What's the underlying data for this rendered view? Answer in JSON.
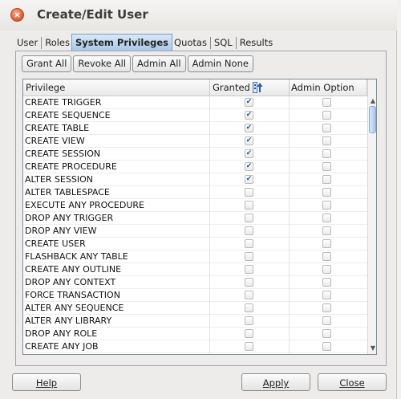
{
  "window": {
    "title": "Create/Edit User",
    "close_glyph": "×"
  },
  "tabs": [
    {
      "label": "User",
      "active": false
    },
    {
      "label": "Roles",
      "active": false
    },
    {
      "label": "System Privileges",
      "active": true
    },
    {
      "label": "Quotas",
      "active": false
    },
    {
      "label": "SQL",
      "active": false
    },
    {
      "label": "Results",
      "active": false
    }
  ],
  "toolbar": {
    "grant_all": "Grant All",
    "revoke_all": "Revoke All",
    "admin_all": "Admin All",
    "admin_none": "Admin None"
  },
  "table": {
    "columns": {
      "privilege": "Privilege",
      "granted": "Granted",
      "admin_option": "Admin Option"
    },
    "sort_icon": "sort-icon",
    "rows": [
      {
        "privilege": "CREATE TRIGGER",
        "granted": true,
        "admin": false
      },
      {
        "privilege": "CREATE SEQUENCE",
        "granted": true,
        "admin": false
      },
      {
        "privilege": "CREATE TABLE",
        "granted": true,
        "admin": false
      },
      {
        "privilege": "CREATE VIEW",
        "granted": true,
        "admin": false
      },
      {
        "privilege": "CREATE SESSION",
        "granted": true,
        "admin": false
      },
      {
        "privilege": "CREATE PROCEDURE",
        "granted": true,
        "admin": false
      },
      {
        "privilege": "ALTER SESSION",
        "granted": true,
        "admin": false
      },
      {
        "privilege": "ALTER TABLESPACE",
        "granted": false,
        "admin": false
      },
      {
        "privilege": "EXECUTE ANY PROCEDURE",
        "granted": false,
        "admin": false
      },
      {
        "privilege": "DROP ANY TRIGGER",
        "granted": false,
        "admin": false
      },
      {
        "privilege": "DROP ANY VIEW",
        "granted": false,
        "admin": false
      },
      {
        "privilege": "CREATE USER",
        "granted": false,
        "admin": false
      },
      {
        "privilege": "FLASHBACK ANY TABLE",
        "granted": false,
        "admin": false
      },
      {
        "privilege": "CREATE ANY OUTLINE",
        "granted": false,
        "admin": false
      },
      {
        "privilege": "DROP ANY CONTEXT",
        "granted": false,
        "admin": false
      },
      {
        "privilege": "FORCE TRANSACTION",
        "granted": false,
        "admin": false
      },
      {
        "privilege": "ALTER ANY SEQUENCE",
        "granted": false,
        "admin": false
      },
      {
        "privilege": "ALTER ANY LIBRARY",
        "granted": false,
        "admin": false
      },
      {
        "privilege": "DROP ANY ROLE",
        "granted": false,
        "admin": false
      },
      {
        "privilege": "CREATE ANY JOB",
        "granted": false,
        "admin": false
      }
    ]
  },
  "footer": {
    "help": "Help",
    "apply": "Apply",
    "close": "Close"
  },
  "colors": {
    "accent": "#2a5fa8",
    "close_button": "#d95a2b",
    "active_tab": "#a9c8ea"
  }
}
